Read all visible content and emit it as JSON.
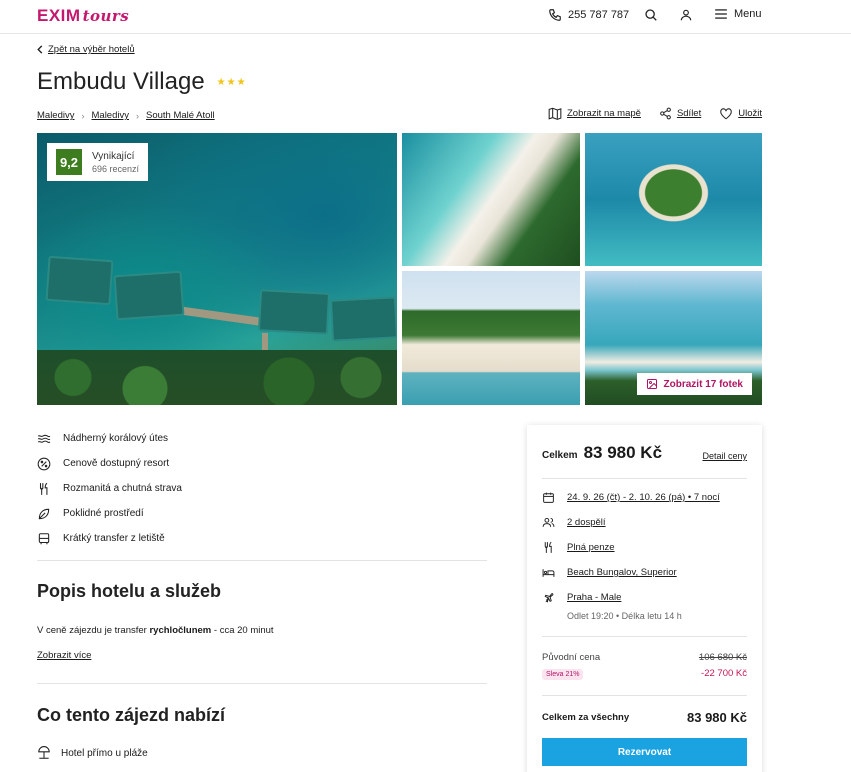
{
  "header": {
    "logo_main": "EXIM",
    "logo_sub": "tours",
    "phone": "255 787 787",
    "menu_label": "Menu"
  },
  "back_link": "Zpět na výběr hotelů",
  "hotel": {
    "name": "Embudu Village",
    "stars": "★★★",
    "breadcrumbs": [
      "Maledivy",
      "Maledivy",
      "South Malé Atoll"
    ]
  },
  "actions": {
    "map": "Zobrazit na mapě",
    "share": "Sdílet",
    "save": "Uložit"
  },
  "rating": {
    "score": "9,2",
    "label": "Vynikající",
    "count": "696 recenzí"
  },
  "gallery": {
    "show_photos": "Zobrazit 17 fotek"
  },
  "features": [
    {
      "icon": "waves-icon",
      "label": "Nádherný korálový útes"
    },
    {
      "icon": "percent-icon",
      "label": "Cenově dostupný resort"
    },
    {
      "icon": "cutlery-icon",
      "label": "Rozmanitá a chutná strava"
    },
    {
      "icon": "leaf-icon",
      "label": "Poklidné prostředí"
    },
    {
      "icon": "bus-icon",
      "label": "Krátký transfer z letiště"
    }
  ],
  "description": {
    "title": "Popis hotelu a služeb",
    "text_before": "V ceně zájezdu je transfer ",
    "text_bold": "rychločlunem",
    "text_after": " - cca 20 minut",
    "more": "Zobrazit více"
  },
  "offer": {
    "title": "Co tento zájezd nabízí",
    "first_item": "Hotel přímo u pláže"
  },
  "booking": {
    "total_label": "Celkem",
    "total_price": "83 980 Kč",
    "detail_link": "Detail ceny",
    "dates": "24. 9. 26 (čt) - 2. 10. 26 (pá) • 7 nocí",
    "guests": "2 dospělí",
    "board": "Plná penze",
    "room": "Beach Bungalov, Superior",
    "flight": "Praha - Male",
    "flight_info": "Odlet 19:20 • Délka letu 14 h",
    "original_label": "Původní cena",
    "original_price": "106 680 Kč",
    "discount_badge": "Sleva 21%",
    "discount_value": "-22 700 Kč",
    "all_label": "Celkem za všechny",
    "all_price": "83 980 Kč",
    "reserve": "Rezervovat"
  },
  "colors": {
    "brand": "#c4186f",
    "accent": "#1aa3e0",
    "rating": "#3d7d1f"
  }
}
